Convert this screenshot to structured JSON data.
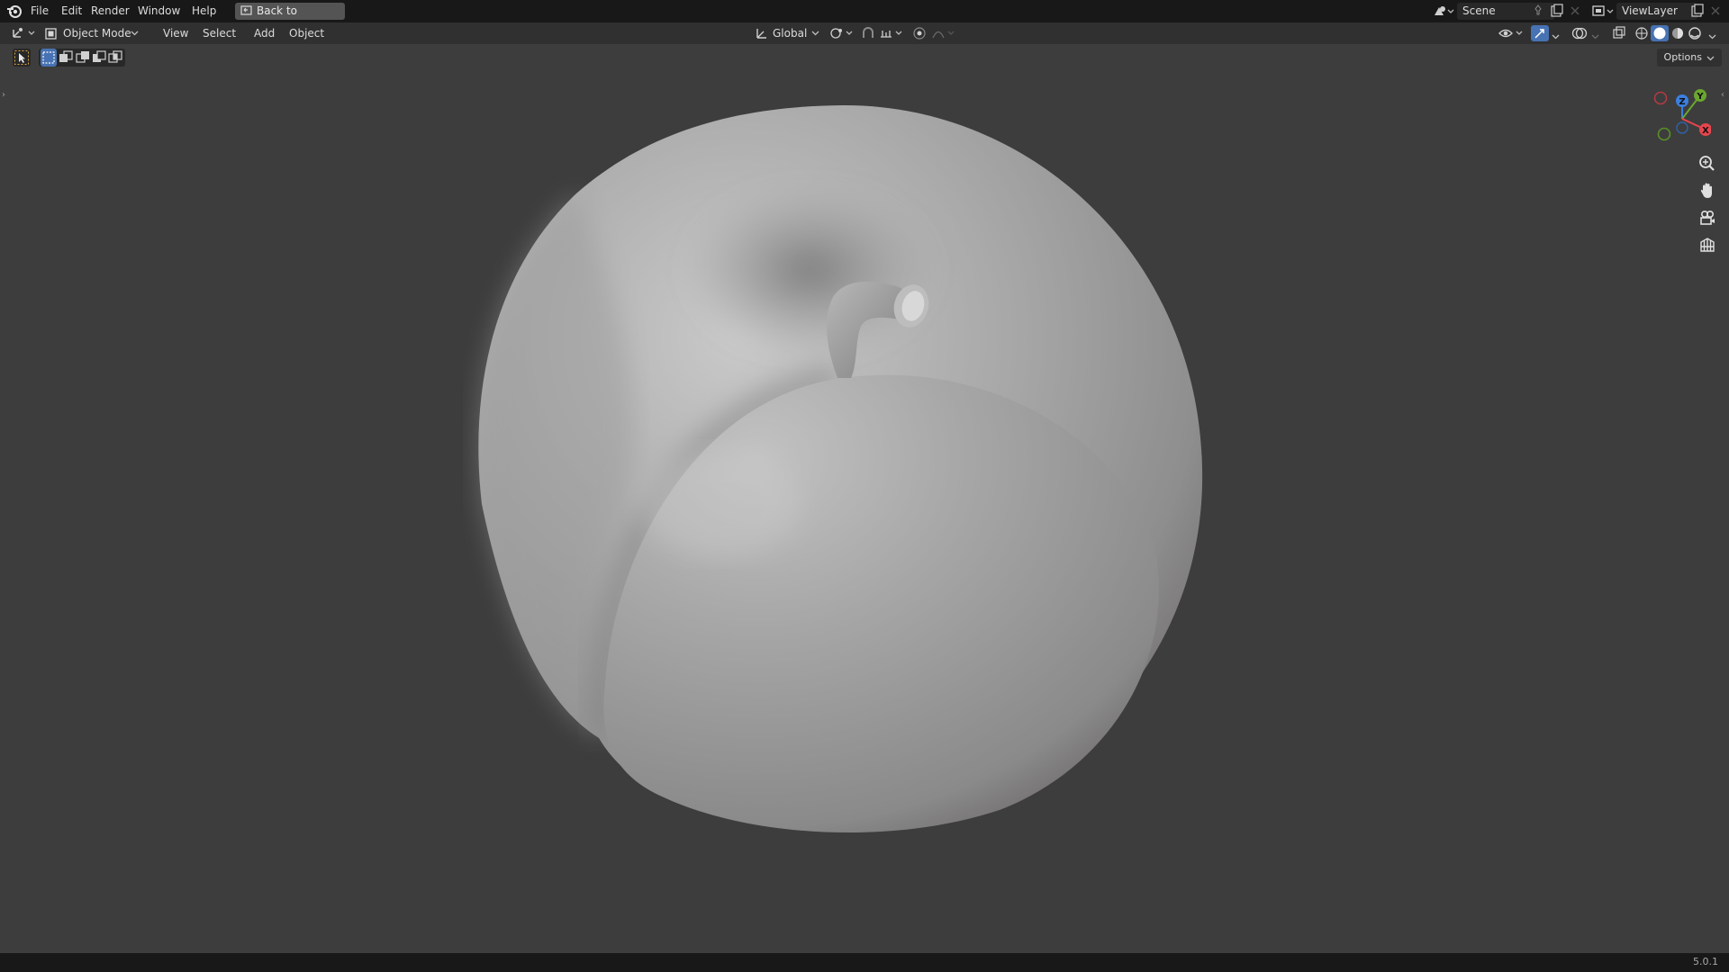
{
  "app": {
    "name": "Blender",
    "version": "5.0.1"
  },
  "menubar": {
    "items": [
      "File",
      "Edit",
      "Render",
      "Window",
      "Help"
    ],
    "back_button": "Back to Previous",
    "scene_field": "Scene",
    "viewlayer_field": "ViewLayer"
  },
  "viewport_header": {
    "mode": "Object Mode",
    "menus": [
      "View",
      "Select",
      "Add",
      "Object"
    ],
    "transform_orientation": "Global",
    "options_label": "Options"
  },
  "viewport": {
    "object": "apple-shaped mesh with stem",
    "shading": "solid",
    "gizmo_axes": {
      "z": "Z",
      "y": "Y",
      "x": "X"
    }
  },
  "icons": {
    "blender_logo": "blender-logo-icon",
    "editor_type": "3d-viewport-icon",
    "zoom": "zoom-icon",
    "pan": "hand-icon",
    "camera": "camera-icon",
    "ortho": "grid-icon"
  },
  "colors": {
    "menubar_bg": "#181818",
    "header_bg": "#303030",
    "viewport_bg": "#3d3d3d",
    "active_blue": "#4772b3",
    "axis_x": "#e8454e",
    "axis_y": "#6ba62f",
    "axis_z": "#3b7fe0"
  }
}
